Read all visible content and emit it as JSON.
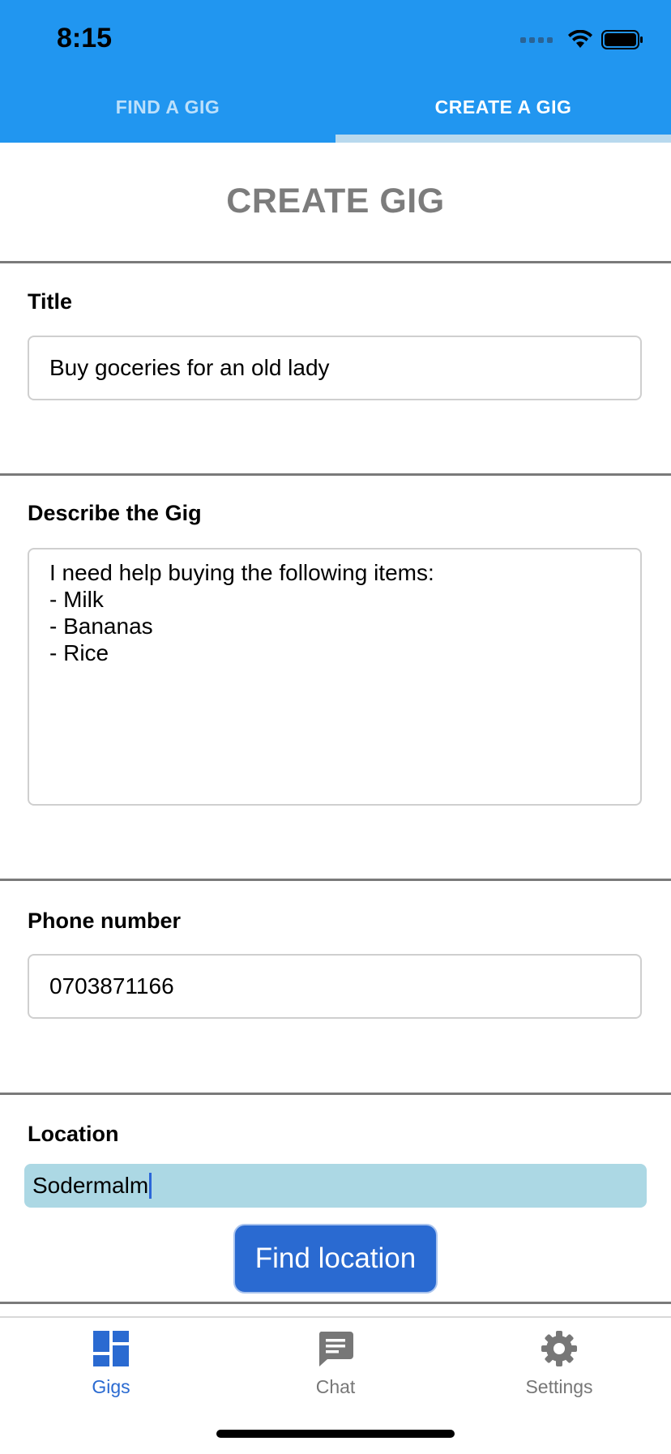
{
  "status_bar": {
    "time": "8:15"
  },
  "tabs": [
    {
      "label": "FIND A GIG",
      "active": false
    },
    {
      "label": "CREATE A GIG",
      "active": true
    }
  ],
  "page": {
    "title": "CREATE GIG"
  },
  "form": {
    "title": {
      "label": "Title",
      "value": "Buy goceries for an old lady"
    },
    "description": {
      "label": "Describe the Gig",
      "value": "I need help buying the following items:\n- Milk\n- Bananas\n- Rice"
    },
    "phone": {
      "label": "Phone number",
      "value": "0703871166"
    },
    "location": {
      "label": "Location",
      "value": "Sodermalm",
      "button_label": "Find location"
    }
  },
  "bottom_nav": {
    "items": [
      {
        "label": "Gigs",
        "icon": "dashboard-icon",
        "active": true
      },
      {
        "label": "Chat",
        "icon": "chat-icon",
        "active": false
      },
      {
        "label": "Settings",
        "icon": "gear-icon",
        "active": false
      }
    ]
  },
  "colors": {
    "header": "#2196f0",
    "accent": "#2a6ad1",
    "location_field": "#acd8e4"
  }
}
